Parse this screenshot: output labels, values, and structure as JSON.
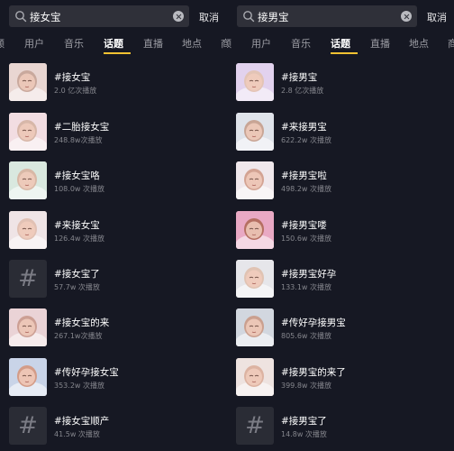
{
  "screens": [
    {
      "search": {
        "query": "接女宝",
        "cancel": "取消"
      },
      "tabs": [
        "频",
        "用户",
        "音乐",
        "话题",
        "直播",
        "地点",
        "商"
      ],
      "active_tab": "话题",
      "topics": [
        {
          "title": "#接女宝",
          "views": "2.0 亿次播放",
          "thumb": "baby",
          "tone": [
            "#e9d6d2",
            "#c9a99d"
          ]
        },
        {
          "title": "#二胎接女宝",
          "views": "248.8w次播放",
          "thumb": "baby",
          "tone": [
            "#f2dde2",
            "#d7b7a9"
          ]
        },
        {
          "title": "#接女宝咯",
          "views": "108.0w 次播放",
          "thumb": "baby",
          "tone": [
            "#d9e8df",
            "#d8b8a6"
          ]
        },
        {
          "title": "#来接女宝",
          "views": "126.4w 次播放",
          "thumb": "baby",
          "tone": [
            "#efe4e6",
            "#e1c1b4"
          ]
        },
        {
          "title": "#接女宝了",
          "views": "57.7w 次播放",
          "thumb": "hash",
          "tone": [
            "#2a2c35",
            "#2a2c35"
          ]
        },
        {
          "title": "#接女宝的来",
          "views": "267.1w次播放",
          "thumb": "baby",
          "tone": [
            "#ead3d6",
            "#cc9f94"
          ]
        },
        {
          "title": "#传好孕接女宝",
          "views": "353.2w 次播放",
          "thumb": "baby",
          "tone": [
            "#c9d4e8",
            "#d39c88"
          ]
        },
        {
          "title": "#接女宝顺产",
          "views": "41.5w 次播放",
          "thumb": "hash",
          "tone": [
            "#2a2c35",
            "#2a2c35"
          ]
        }
      ]
    },
    {
      "search": {
        "query": "接男宝",
        "cancel": "取消"
      },
      "tabs": [
        "频",
        "用户",
        "音乐",
        "话题",
        "直播",
        "地点",
        "商"
      ],
      "active_tab": "话题",
      "topics": [
        {
          "title": "#接男宝",
          "views": "2.8 亿次播放",
          "thumb": "baby",
          "tone": [
            "#e2d2ee",
            "#e3c4b6"
          ]
        },
        {
          "title": "#来接男宝",
          "views": "622.2w 次播放",
          "thumb": "baby",
          "tone": [
            "#dfe3ea",
            "#c8a595"
          ]
        },
        {
          "title": "#接男宝啦",
          "views": "498.2w 次播放",
          "thumb": "baby",
          "tone": [
            "#f0e8ec",
            "#d3a393"
          ]
        },
        {
          "title": "#接男宝喽",
          "views": "150.6w 次播放",
          "thumb": "baby",
          "tone": [
            "#e9a9c4",
            "#b56f62"
          ]
        },
        {
          "title": "#接男宝好孕",
          "views": "133.1w 次播放",
          "thumb": "baby",
          "tone": [
            "#e6e6ea",
            "#e0c3b3"
          ]
        },
        {
          "title": "#传好孕接男宝",
          "views": "805.6w 次播放",
          "thumb": "baby",
          "tone": [
            "#d2d7df",
            "#caa08f"
          ]
        },
        {
          "title": "#接男宝的来了",
          "views": "399.8w 次播放",
          "thumb": "baby",
          "tone": [
            "#eee3e0",
            "#dcb3a2"
          ]
        },
        {
          "title": "#接男宝了",
          "views": "14.8w 次播放",
          "thumb": "hash",
          "tone": [
            "#2a2c35",
            "#2a2c35"
          ]
        }
      ]
    }
  ],
  "colors": {
    "background": "#161823",
    "search_box": "#2f3039",
    "tab_inactive": "#9c9da4",
    "tab_underline": "#f4c232",
    "subtext": "#85868d"
  },
  "icons": {
    "search": "magnifier-icon",
    "clear": "clear-circle-icon",
    "topic_placeholder": "#"
  }
}
